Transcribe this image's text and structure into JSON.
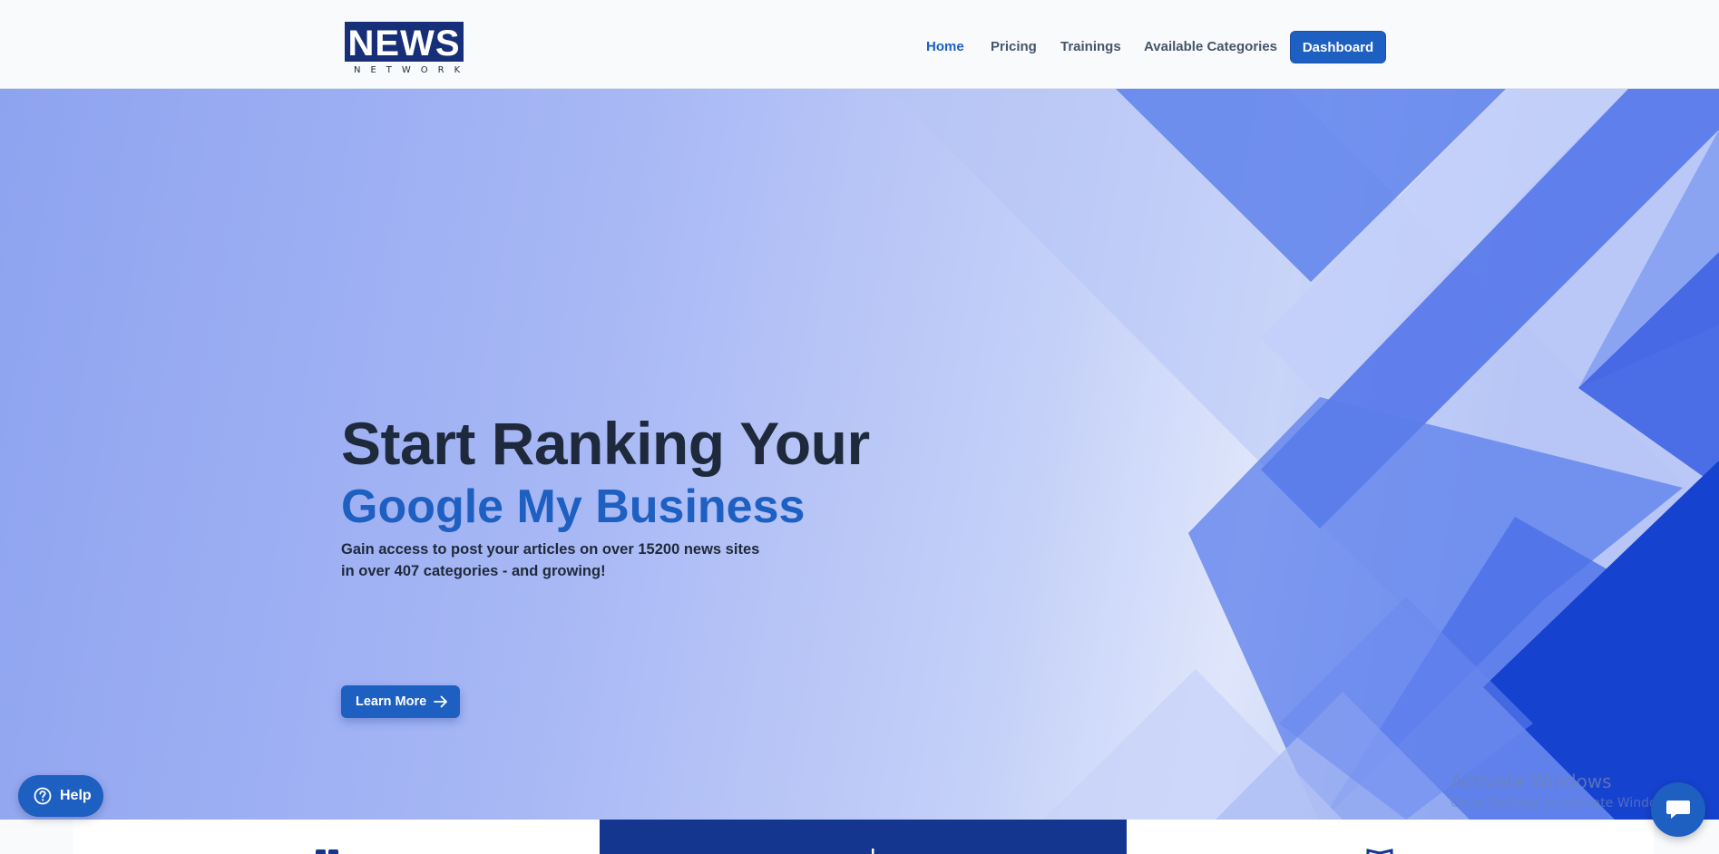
{
  "header": {
    "logo": {
      "main": "NEWS",
      "sub": "NETWORK"
    },
    "nav": [
      {
        "label": "Home",
        "active": true
      },
      {
        "label": "Pricing",
        "active": false
      },
      {
        "label": "Trainings",
        "active": false
      },
      {
        "label": "Available Categories",
        "active": false
      }
    ],
    "dashboard_label": "Dashboard"
  },
  "hero": {
    "title": "Start Ranking Your",
    "subtitle": "Google My Business",
    "description_line1": "Gain access to post your articles on over 15200 news sites",
    "description_line2": "in over 407 categories - and growing!",
    "cta_label": "Learn More",
    "cta_icon": "arrow-right-icon"
  },
  "help": {
    "label": "Help",
    "icon": "question-circle-icon"
  },
  "watermark": {
    "title": "Activate Windows",
    "subtitle": "Go to Settings to activate Windows."
  },
  "chat": {
    "icon": "chat-bubble-icon"
  },
  "colors": {
    "primary": "#1e5fc2",
    "dark_navy": "#15368f",
    "text_dark": "#1e293b",
    "nav_gray": "#475569"
  }
}
